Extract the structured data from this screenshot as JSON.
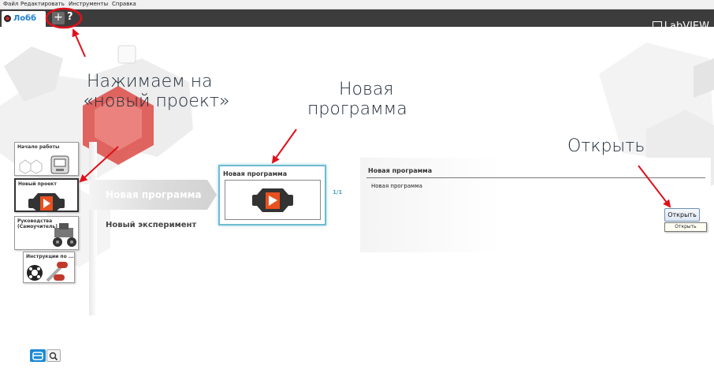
{
  "menu": {
    "items": [
      "Файл",
      "Редактировать",
      "Инструменты",
      "Справка"
    ]
  },
  "tabs": {
    "lobby_label": "Лобб",
    "new_project_icon": "plus-icon",
    "help_icon": "question-icon"
  },
  "brand": {
    "name": "LabVIEW"
  },
  "sidebar": {
    "items": [
      {
        "label": "Начало работы",
        "icon": "robot-brick-icon",
        "selected": false
      },
      {
        "label": "Новый проект",
        "icon": "program-play-icon",
        "selected": true
      },
      {
        "label": "Руководства (Самоучитель)",
        "icon": "robot-vehicle-icon",
        "selected": false
      },
      {
        "label": "Инструкции по ...",
        "icon": "gears-icon",
        "selected": false
      }
    ]
  },
  "main": {
    "ribbon_label": "Новая программа",
    "experiment_label": "Новый эксперимент",
    "card": {
      "title": "Новая программа",
      "thumb_icon": "program-play-icon"
    },
    "pager": "1/1"
  },
  "detail": {
    "heading": "Новая программа",
    "description": "Новая программа",
    "open_button": "Открыть",
    "tooltip": "Открыть"
  },
  "annotations": {
    "new_project_line1": "Нажимаем на",
    "new_project_line2": "«новый проект»",
    "new_program_line1": "Новая",
    "new_program_line2": "программа",
    "open": "Открыть"
  },
  "bottom": {
    "icons": [
      "list-view-icon",
      "search-icon"
    ]
  },
  "colors": {
    "accent_blue": "#1a8ad4",
    "annotation_red": "#e0101a",
    "card_border": "#6fbccd",
    "tabbar": "#3c3c3c"
  }
}
